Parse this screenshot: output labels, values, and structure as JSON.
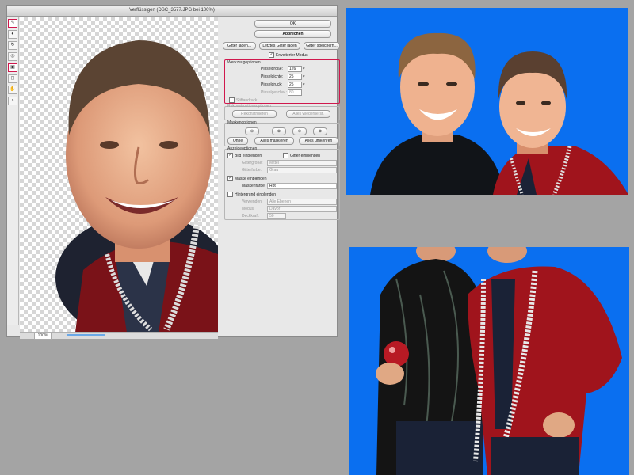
{
  "window": {
    "title": "Verflüssigen (DSC_3577.JPG bei 100%)",
    "zoom": "100%",
    "progress": 0.15
  },
  "tools": [
    {
      "name": "forward-warp-tool",
      "glyph": "✎"
    },
    {
      "name": "reconstruct-tool",
      "glyph": "◐"
    },
    {
      "name": "twirl-tool",
      "glyph": "↻"
    },
    {
      "name": "pucker-tool",
      "glyph": "◎"
    },
    {
      "name": "freeze-mask-tool",
      "glyph": "▣"
    },
    {
      "name": "thaw-mask-tool",
      "glyph": "◻"
    },
    {
      "name": "hand-tool",
      "glyph": "✋"
    },
    {
      "name": "zoom-tool",
      "glyph": "⌕"
    }
  ],
  "panel": {
    "ok_label": "OK",
    "cancel_label": "Abbrechen",
    "load_mesh": "Gitter laden...",
    "load_last_mesh": "Letztes Gitter laden",
    "save_mesh": "Gitter speichern...",
    "advanced_mode": "Erweiterter Modus",
    "tool_options": {
      "title": "Werkzeugoptionen",
      "brush_size_label": "Pinselgröße:",
      "brush_size": "126",
      "brush_density_label": "Pinseldichte:",
      "brush_density": "25",
      "brush_pressure_label": "Pinseldruck:",
      "brush_pressure": "25",
      "brush_rate_label": "Pinselgeschw.:",
      "brush_rate": "80",
      "stylus_pressure": "Stiftandruck"
    },
    "reconstruct": {
      "title": "Rekonstruktionsoptionen",
      "reconstruct_btn": "Rekonstruieren",
      "restore_all_btn": "Alles wiederherst."
    },
    "mask": {
      "title": "Maskenoptionen",
      "none_btn": "Ohne",
      "mask_all_btn": "Alles maskieren",
      "invert_all_btn": "Alles umkehren"
    },
    "view": {
      "title": "Anzeigeoptionen",
      "show_image": "Bild einblenden",
      "show_mesh": "Gitter einblenden",
      "mesh_size_label": "Gittergröße:",
      "mesh_size": "Mittel",
      "mesh_color_label": "Gitterfarbe:",
      "mesh_color": "Grau",
      "show_mask": "Maske einblenden",
      "mask_color_label": "Maskenfarbe:",
      "mask_color": "Rot",
      "show_backdrop": "Hintergrund einblenden",
      "use_label": "Verwenden:",
      "use_value": "Alle Ebenen",
      "mode_label": "Modus:",
      "mode_value": "Davor",
      "opacity_label": "Deckkraft:",
      "opacity_value": "50"
    }
  },
  "colors": {
    "highlight": "#d0184d",
    "blue_bg": "#0a6ff0",
    "gray_bg": "#a4a4a4"
  }
}
